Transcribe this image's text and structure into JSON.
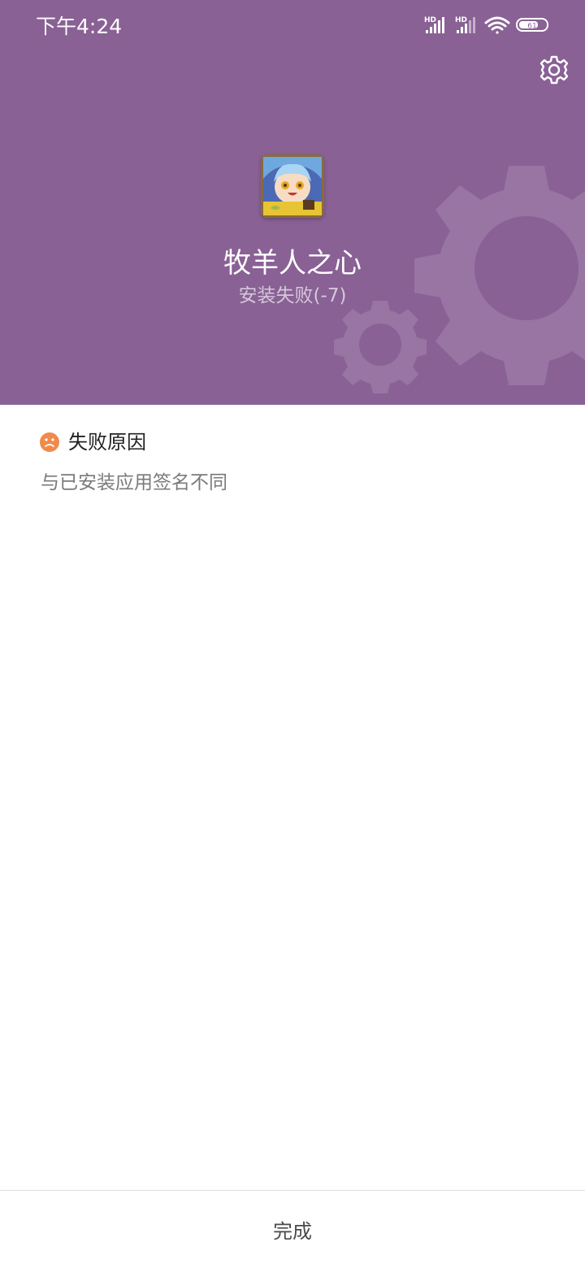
{
  "status_bar": {
    "time": "下午4:24",
    "signal_1_label": "HD",
    "signal_2_label": "HD",
    "battery_level": "61"
  },
  "header": {
    "background_color": "#896195",
    "settings_icon": "gear-icon",
    "app_name": "牧羊人之心",
    "install_status": "安装失败(-7)"
  },
  "reason": {
    "icon": "sad-face-icon",
    "icon_color": "#f08a4b",
    "title": "失败原因",
    "text": "与已安装应用签名不同"
  },
  "footer": {
    "done_label": "完成"
  }
}
